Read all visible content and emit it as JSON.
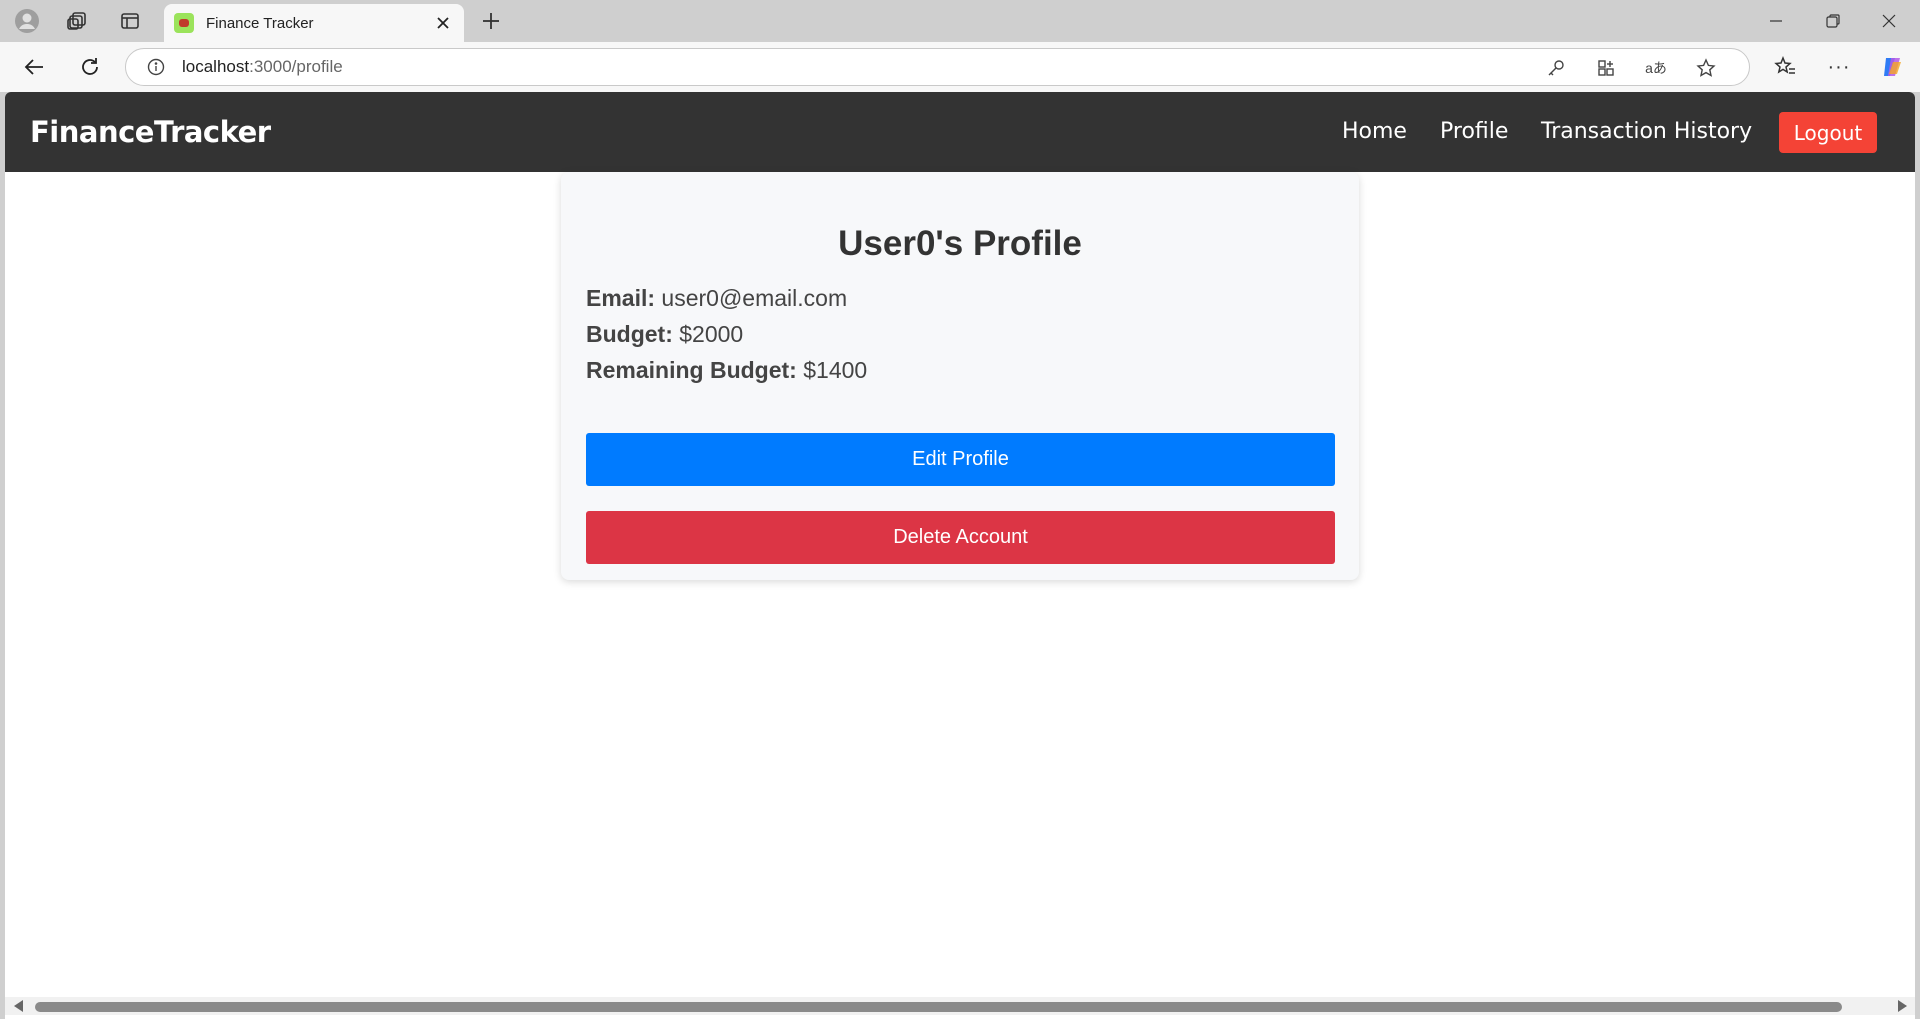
{
  "browser": {
    "tab_title": "Finance Tracker",
    "url_host": "localhost",
    "url_path": ":3000/profile",
    "icons": {
      "profile": "person-icon",
      "workspaces": "workspaces-icon",
      "tab_actions": "tab-actions-icon",
      "close_tab": "close-icon",
      "new_tab": "plus-icon",
      "back": "back-arrow-icon",
      "reload": "reload-icon",
      "site_info": "info-icon",
      "password": "key-icon",
      "app": "app-grid-icon",
      "translate": "translate-icon",
      "favorite": "star-icon",
      "favorites": "favorites-icon",
      "more": "more-icon",
      "copilot": "copilot-icon"
    }
  },
  "navbar": {
    "brand": "FinanceTracker",
    "links": [
      "Home",
      "Profile",
      "Transaction History"
    ],
    "logout_label": "Logout"
  },
  "profile": {
    "title": "User0's Profile",
    "email_label": "Email:",
    "email_value": "user0@email.com",
    "budget_label": "Budget:",
    "budget_value": "$2000",
    "remaining_label": "Remaining Budget:",
    "remaining_value": "$1400",
    "edit_button": "Edit Profile",
    "delete_button": "Delete Account"
  },
  "colors": {
    "navbar_bg": "#333333",
    "logout_bg": "#f44336",
    "edit_bg": "#007bff",
    "delete_bg": "#dc3545"
  }
}
